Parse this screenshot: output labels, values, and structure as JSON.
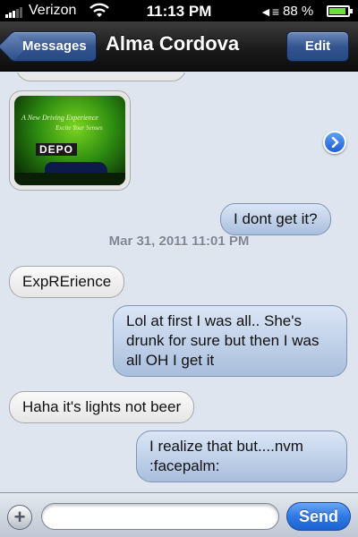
{
  "status_bar": {
    "carrier": "Verizon",
    "time": "11:13 PM",
    "battery_percent": "88 %",
    "battery_level": 0.88,
    "icons": [
      "signal-bars-icon",
      "wifi-icon",
      "volume-icon",
      "battery-icon"
    ]
  },
  "nav": {
    "back_label": "Messages",
    "title": "Alma Cordova",
    "edit_label": "Edit"
  },
  "thread": {
    "photo_message": {
      "caption_line1": "A New Driving Experience",
      "caption_line2": "Excite Your Senses",
      "brand": "DEPO",
      "detail_icon": "chevron-right-icon"
    },
    "timestamp": "Mar 31, 2011 11:01 PM",
    "messages": [
      {
        "direction": "outgoing",
        "text": "I dont get it?"
      },
      {
        "direction": "incoming",
        "text": "ExpRErience"
      },
      {
        "direction": "outgoing",
        "text": "Lol at first I was all.. She's drunk for sure but then I was all OH I get it"
      },
      {
        "direction": "incoming",
        "text": "Haha it's lights not beer"
      },
      {
        "direction": "outgoing",
        "text": "I realize that but....nvm :facepalm:"
      }
    ]
  },
  "composer": {
    "add_label": "+",
    "input_value": "",
    "send_label": "Send"
  },
  "colors": {
    "nav_button": "#34558f",
    "outgoing_bubble": "#a9bedd",
    "incoming_bubble": "#e6e6e6",
    "send_button": "#2f78e6",
    "battery_fill": "#6fdc3f"
  }
}
